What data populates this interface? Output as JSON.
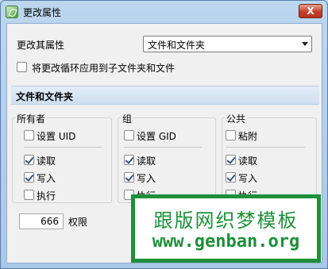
{
  "window": {
    "title": "更改属性",
    "close_label": "X"
  },
  "top": {
    "change_label": "更改其属性",
    "target_select_value": "文件和文件夹",
    "recursive_label": "将更改循环应用到子文件夹和文件",
    "recursive_checked": false
  },
  "section": {
    "title": "文件和文件夹"
  },
  "groups": [
    {
      "title": "所有者",
      "special_label": "设置 UID",
      "special_checked": false,
      "read_label": "读取",
      "read_checked": true,
      "write_label": "写入",
      "write_checked": true,
      "exec_label": "执行",
      "exec_checked": false
    },
    {
      "title": "组",
      "special_label": "设置 GID",
      "special_checked": false,
      "read_label": "读取",
      "read_checked": true,
      "write_label": "写入",
      "write_checked": true,
      "exec_label": "执行",
      "exec_checked": false
    },
    {
      "title": "公共",
      "special_label": "粘附",
      "special_checked": false,
      "read_label": "读取",
      "read_checked": true,
      "write_label": "写入",
      "write_checked": true,
      "exec_label": "执行",
      "exec_checked": false
    }
  ],
  "permission": {
    "value": "666",
    "label": "权限"
  },
  "watermark": {
    "line1": "跟版网织梦模板",
    "line2": "www.genban.org",
    "color": "#1e8f3a"
  }
}
